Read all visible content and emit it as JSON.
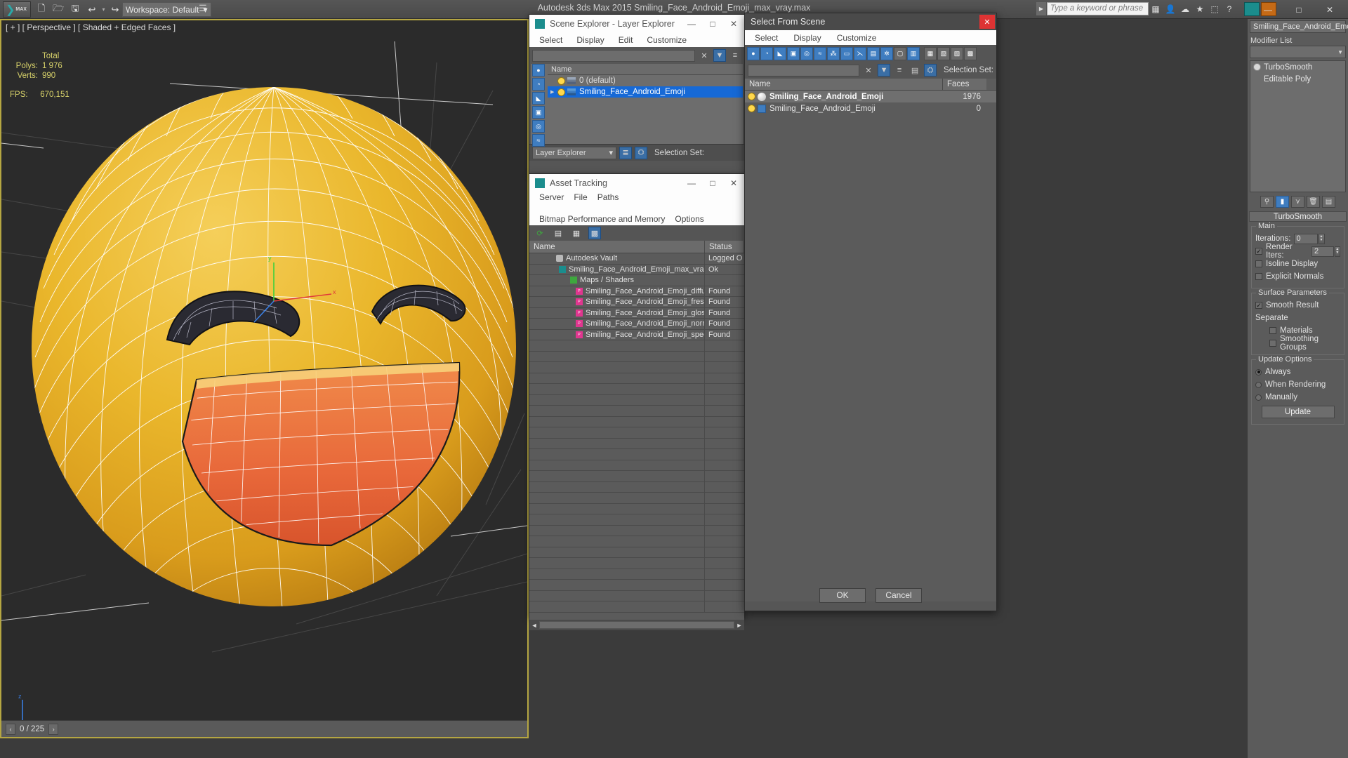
{
  "topbar": {
    "logo_text": "MAX",
    "quick_icons": [
      "new-file-icon",
      "open-file-icon",
      "save-file-icon",
      "undo-icon",
      "redo-icon",
      "set-project-icon"
    ],
    "workspace_label": "Workspace: Default",
    "app_title": "Autodesk 3ds Max  2015    Smiling_Face_Android_Emoji_max_vray.max",
    "search_placeholder": "Type a keyword or phrase",
    "minimize": "—",
    "maximize": "□",
    "close": "✕"
  },
  "viewport": {
    "label": "[ + ] [ Perspective ] [ Shaded + Edged Faces ]",
    "stats_header": "Total",
    "stats": [
      {
        "label": "Polys:",
        "value": "1 976"
      },
      {
        "label": "Verts:",
        "value": "990"
      }
    ],
    "fps_label": "FPS:",
    "fps_value": "670,151",
    "axis_x": "x",
    "axis_y": "y",
    "axis_z": "z"
  },
  "statusbar": {
    "frame_counter": "0 / 225",
    "prev_arrow": "‹",
    "next_arrow": "›"
  },
  "scene_explorer": {
    "title": "Scene Explorer - Layer Explorer",
    "icon": "max-app-icon",
    "min": "—",
    "max": "□",
    "close": "✕",
    "menu": [
      "Select",
      "Display",
      "Edit",
      "Customize"
    ],
    "filter_clear": "✕",
    "left_icons": [
      "sphere-filter-icon",
      "shape-filter-icon",
      "light-filter-icon",
      "camera-filter-icon",
      "helper-filter-icon",
      "spacewarp-filter-icon"
    ],
    "column_name": "Name",
    "rows": [
      {
        "label": "0 (default)",
        "selected": false,
        "expandable": false
      },
      {
        "label": "Smiling_Face_Android_Emoji",
        "selected": true,
        "expandable": true
      }
    ],
    "footer_combo": "Layer Explorer",
    "footer_selset_label": "Selection Set:"
  },
  "asset_tracking": {
    "title": "Asset Tracking",
    "icon": "max-app-icon",
    "min": "—",
    "max": "□",
    "close": "✕",
    "menu_row1": [
      "Server",
      "File",
      "Paths",
      "Bitmap Performance and Memory"
    ],
    "menu_row2": [
      "Options"
    ],
    "toolbar_icons": [
      "refresh-icon",
      "list-view-icon",
      "detail-view-icon",
      "grid-view-icon"
    ],
    "columns": [
      "Name",
      "Status"
    ],
    "rows": [
      {
        "name": "Autodesk Vault",
        "status": "Logged O",
        "indent": 1,
        "icon": "vault-icon"
      },
      {
        "name": "Smiling_Face_Android_Emoji_max_vray.max",
        "status": "Ok",
        "indent": 2,
        "icon": "max-file-icon"
      },
      {
        "name": "Maps / Shaders",
        "status": "",
        "indent": 3,
        "icon": "maps-icon"
      },
      {
        "name": "Smiling_Face_Android_Emoji_diffuse.p...",
        "status": "Found",
        "indent": 4,
        "icon": "png-icon"
      },
      {
        "name": "Smiling_Face_Android_Emoji_fresnel.p...",
        "status": "Found",
        "indent": 4,
        "icon": "png-icon"
      },
      {
        "name": "Smiling_Face_Android_Emoji_glossines...",
        "status": "Found",
        "indent": 4,
        "icon": "png-icon"
      },
      {
        "name": "Smiling_Face_Android_Emoji_normal.p...",
        "status": "Found",
        "indent": 4,
        "icon": "png-icon"
      },
      {
        "name": "Smiling_Face_Android_Emoji_specular....",
        "status": "Found",
        "indent": 4,
        "icon": "png-icon"
      }
    ],
    "scroll_left": "◄",
    "scroll_right": "►"
  },
  "select_from_scene": {
    "title": "Select From Scene",
    "close": "✕",
    "menu": [
      "Select",
      "Display",
      "Customize"
    ],
    "toolbar_icons": [
      "geometry-filter-icon",
      "shapes-filter-icon",
      "lights-filter-icon",
      "cameras-filter-icon",
      "helpers-filter-icon",
      "spacewarps-filter-icon",
      "particle-filter-icon",
      "bone-filter-icon",
      "ik-filter-icon",
      "group-filter-icon",
      "xref-filter-icon",
      "frozen-filter-icon",
      "hidden-filter-icon",
      "none-filter-icon",
      "invert-filter-icon",
      "filter-icon",
      "layers-icon",
      "hierarchy-icon"
    ],
    "filter_clear": "✕",
    "selection_set_label": "Selection Set:",
    "columns": [
      "Name",
      "Faces"
    ],
    "rows": [
      {
        "name": "Smiling_Face_Android_Emoji",
        "faces": "1976",
        "selected": true,
        "icon": "sphere-icon"
      },
      {
        "name": "Smiling_Face_Android_Emoji",
        "faces": "0",
        "selected": false,
        "icon": "shape-icon"
      }
    ],
    "ok_label": "OK",
    "cancel_label": "Cancel"
  },
  "command_panel": {
    "object_name": "Smiling_Face_Android_Emoji",
    "modifier_list_label": "Modifier List",
    "stack": [
      {
        "label": "TurboSmooth",
        "has_eye": true
      },
      {
        "label": "Editable Poly",
        "has_eye": false
      }
    ],
    "stack_tools": [
      "pin-stack-icon",
      "show-end-result-icon",
      "make-unique-icon",
      "remove-modifier-icon",
      "configure-sets-icon"
    ],
    "rollout_title": "TurboSmooth",
    "groups": [
      {
        "title": "Main",
        "fields": [
          {
            "type": "spinner",
            "label": "Iterations:",
            "value": "0"
          },
          {
            "type": "checkbox_spinner",
            "label": "Render Iters:",
            "value": "2",
            "checked": true
          },
          {
            "type": "checkbox",
            "label": "Isoline Display",
            "checked": false
          },
          {
            "type": "checkbox",
            "label": "Explicit Normals",
            "checked": false
          }
        ]
      },
      {
        "title": "Surface Parameters",
        "fields": [
          {
            "type": "checkbox",
            "label": "Smooth Result",
            "checked": true
          },
          {
            "type": "label",
            "label": "Separate"
          },
          {
            "type": "checkbox",
            "label": "Materials",
            "checked": false,
            "indent": true
          },
          {
            "type": "checkbox",
            "label": "Smoothing Groups",
            "checked": false,
            "indent": true
          }
        ]
      },
      {
        "title": "Update Options",
        "fields": [
          {
            "type": "radio",
            "label": "Always",
            "checked": true
          },
          {
            "type": "radio",
            "label": "When Rendering",
            "checked": false
          },
          {
            "type": "radio",
            "label": "Manually",
            "checked": false
          }
        ]
      }
    ],
    "update_button": "Update"
  },
  "colors": {
    "accent_blue": "#1669d6",
    "viewport_border": "#b5a642",
    "stats_yellow": "#d8d26a",
    "emoji_yellow": "#e9b529",
    "emoji_mouth": "#e8683a",
    "teal": "#1b8d8d"
  }
}
